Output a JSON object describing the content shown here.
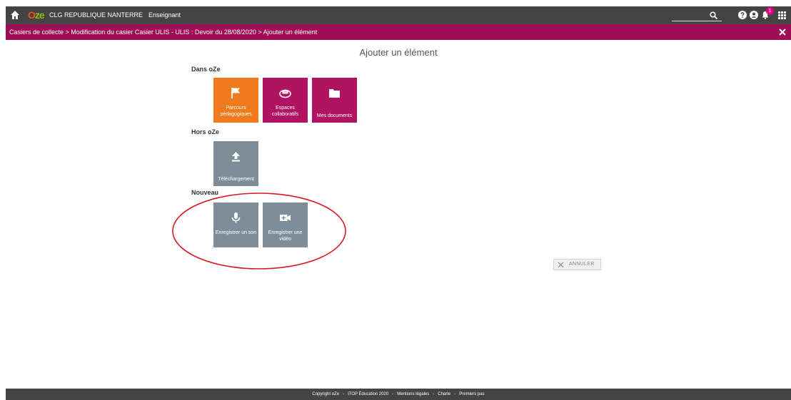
{
  "topbar": {
    "logo_o": "O",
    "logo_ze": "ze",
    "school": "CLG REPUBLIQUE NANTERRE",
    "role": "Enseignant",
    "search_placeholder": "",
    "notification_count": "1"
  },
  "breadcrumb": {
    "text": "Casiers de collecte > Modification du casier Casier ULIS - ULIS : Devoir du 28/08/2020 > Ajouter un élément"
  },
  "main": {
    "title": "Ajouter un élément",
    "sections": {
      "dans_oze": "Dans oZe",
      "hors_oze": "Hors oZe",
      "nouveau": "Nouveau"
    },
    "tiles": {
      "parcours": "Parcours pédagogiques",
      "espaces": "Espaces collaboratifs",
      "documents": "Mes documents",
      "telechargement": "Téléchargement",
      "son": "Enregistrer un son",
      "video": "Enregistrer une vidéo"
    },
    "cancel_label": "ANNULER"
  },
  "footer": {
    "copyright": "Copyright oZe",
    "itop": "ITOP Éducation 2020",
    "mentions": "Mentions légales",
    "charte": "Charte",
    "premiers_pas": "Premiers pas"
  },
  "colors": {
    "topbar": "#444444",
    "breadcrumb": "#9e0e54",
    "orange_tile": "#f07b1d",
    "purple_tile": "#b01361",
    "grey_tile": "#7d8e99",
    "annotation": "#d9181f"
  },
  "icons": {
    "home": "home-icon",
    "search": "search-icon",
    "help": "help-icon",
    "user": "user-icon",
    "bell": "bell-icon",
    "apps": "apps-grid-icon",
    "close": "close-icon",
    "flag": "flag-icon",
    "group": "group-icon",
    "folder": "folder-icon",
    "upload": "upload-icon",
    "mic": "microphone-icon",
    "camera": "video-camera-icon"
  }
}
